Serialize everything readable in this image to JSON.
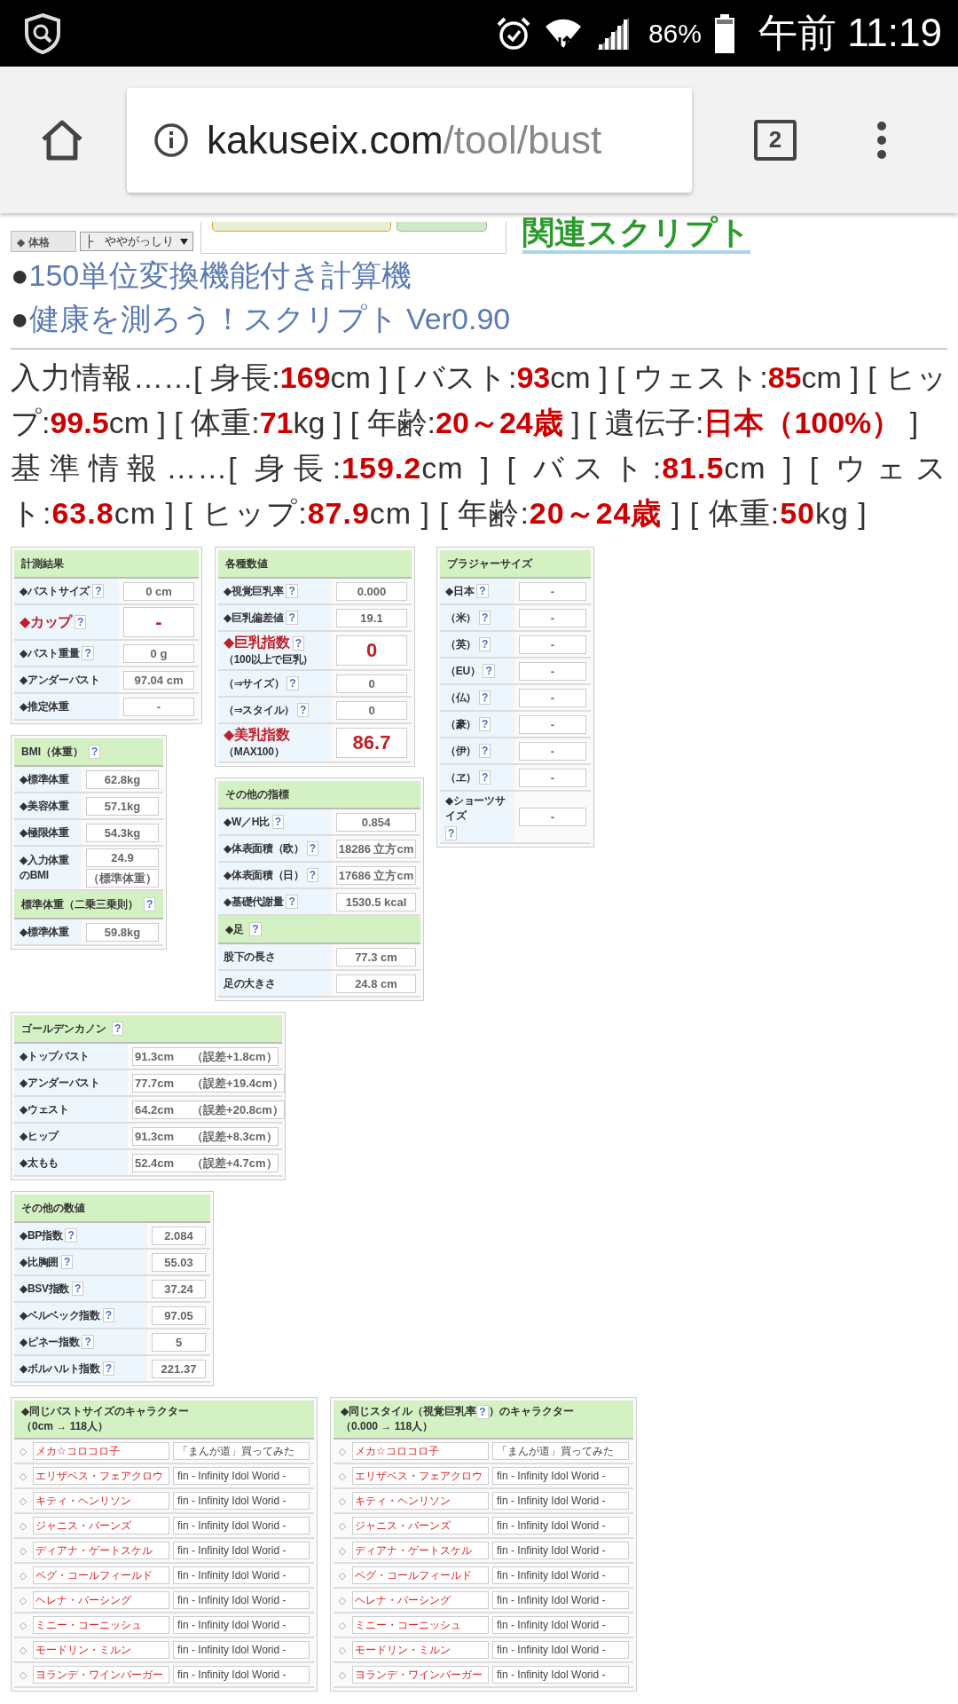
{
  "status_bar": {
    "battery": "86%",
    "time": "午前 11:19"
  },
  "browser": {
    "url_host": "kakuseix.com",
    "url_path": "/tool/bust",
    "tab_count": "2"
  },
  "form_row": {
    "label": "◆ 体格",
    "select_value": "├　ややがっしり"
  },
  "related_heading": "関連スクリプト",
  "links": [
    {
      "bullet": "●",
      "text": "150単位変換機能付き計算機"
    },
    {
      "bullet": "●",
      "text": "健康を測ろう！スクリプト Ver0.90"
    }
  ],
  "info": [
    "入力情報……[ 身長:**169**cm ] [ バスト:**93**cm ] [ ウェスト:**85**cm ] [ ヒップ:**99.5**cm ] [ 体重:**71**kg ] [ 年齢:**20～24歳** ] [ 遺伝子:**日本（100%）** ]",
    "基準情報……[ 身長:**159.2**cm ] [ バスト:**81.5**cm ] [ ウェスト:**63.8**cm ] [ ヒップ:**87.9**cm ] [ 年齢:**20～24歳** ] [ 体重:**50**kg ]"
  ],
  "panels": [
    {
      "title": "計測結果",
      "rows": [
        {
          "kind": "field",
          "label": "◆バストサイズ",
          "help": "?",
          "values": [
            "0 cm"
          ],
          "emphasis": false
        },
        {
          "kind": "field",
          "label": "◆カップ",
          "help": "?",
          "values": [
            "-"
          ],
          "emphasis": true
        },
        {
          "kind": "field",
          "label": "◆バスト重量",
          "help": "?",
          "values": [
            "0 g"
          ],
          "emphasis": false
        },
        {
          "kind": "field",
          "label": "◆アンダーバスト",
          "values": [
            "97.04 cm"
          ],
          "emphasis": false
        },
        {
          "kind": "field",
          "label": "◆推定体重",
          "values": [
            "-"
          ],
          "emphasis": false
        }
      ]
    },
    {
      "title": "各種数値",
      "rows": [
        {
          "kind": "field",
          "label": "◆視覚巨乳率",
          "help": "?",
          "values": [
            "0.000"
          ],
          "emphasis": false
        },
        {
          "kind": "field",
          "label": "◆巨乳偏差値",
          "help": "?",
          "values": [
            "19.1"
          ],
          "emphasis": false
        },
        {
          "kind": "field",
          "label": "◆巨乳指数",
          "help": "?",
          "note": "（100以上で巨乳）",
          "values": [
            "0"
          ],
          "emphasis": true
        },
        {
          "kind": "field",
          "label": "（⇒サイズ）",
          "help": "?",
          "values": [
            "0"
          ],
          "emphasis": false
        },
        {
          "kind": "field",
          "label": "（⇒スタイル）",
          "help": "?",
          "values": [
            "0"
          ],
          "emphasis": false
        },
        {
          "kind": "field",
          "label": "◆美乳指数",
          "note": "（MAX100）",
          "values": [
            "86.7"
          ],
          "emphasis": true
        }
      ]
    },
    {
      "title": "ブラジャーサイズ",
      "rows": [
        {
          "kind": "field",
          "label": "◆日本",
          "help": "?",
          "values": [
            "-"
          ]
        },
        {
          "kind": "field",
          "label": "（米）",
          "help": "?",
          "values": [
            "-"
          ]
        },
        {
          "kind": "field",
          "label": "（英）",
          "help": "?",
          "values": [
            "-"
          ]
        },
        {
          "kind": "field",
          "label": "（EU）",
          "help": "?",
          "values": [
            "-"
          ]
        },
        {
          "kind": "field",
          "label": "（仏）",
          "help": "?",
          "values": [
            "-"
          ]
        },
        {
          "kind": "field",
          "label": "（豪）",
          "help": "?",
          "values": [
            "-"
          ]
        },
        {
          "kind": "field",
          "label": "（伊）",
          "help": "?",
          "values": [
            "-"
          ]
        },
        {
          "kind": "field",
          "label": "（ヱ）",
          "help": "?",
          "values": [
            "-"
          ]
        },
        {
          "kind": "field",
          "label": "◆ショーツサイズ",
          "help": "?",
          "values": [
            "-"
          ]
        }
      ]
    },
    {
      "title": "BMI（体重）",
      "help": "?",
      "rows": [
        {
          "kind": "field",
          "label": "◆標準体重",
          "values": [
            "62.8kg"
          ]
        },
        {
          "kind": "field",
          "label": "◆美容体重",
          "values": [
            "57.1kg"
          ]
        },
        {
          "kind": "field",
          "label": "◆極限体重",
          "values": [
            "54.3kg"
          ]
        },
        {
          "kind": "field",
          "label": "◆入力体重のBMI",
          "values": [
            "24.9",
            "（標準体重）"
          ]
        },
        {
          "kind": "header",
          "label": "標準体重（二乗三乗則）",
          "help": "?"
        },
        {
          "kind": "field",
          "label": "◆標準体重",
          "values": [
            "59.8kg"
          ]
        }
      ]
    },
    {
      "title": "その他の指標",
      "rows": [
        {
          "kind": "field",
          "label": "◆W／H比",
          "help": "?",
          "values": [
            "0.854"
          ]
        },
        {
          "kind": "field",
          "label": "◆体表面積（欧）",
          "help": "?",
          "values": [
            "18286 立方cm"
          ]
        },
        {
          "kind": "field",
          "label": "◆体表面積（日）",
          "help": "?",
          "values": [
            "17686 立方cm"
          ]
        },
        {
          "kind": "field",
          "label": "◆基礎代謝量",
          "help": "?",
          "values": [
            "1530.5 kcal"
          ]
        },
        {
          "kind": "header",
          "label": "◆足",
          "help": "?"
        },
        {
          "kind": "field",
          "label": "股下の長さ",
          "values": [
            "77.3 cm"
          ]
        },
        {
          "kind": "field",
          "label": "足の大きさ",
          "values": [
            "24.8 cm"
          ]
        }
      ]
    },
    {
      "title": "ゴールデンカノン",
      "help": "?",
      "rows": [
        {
          "kind": "field",
          "label": "◆トップバスト",
          "values": [
            "91.3cm"
          ],
          "error": "（誤差+1.8cm）"
        },
        {
          "kind": "field",
          "label": "◆アンダーバスト",
          "values": [
            "77.7cm"
          ],
          "error": "（誤差+19.4cm）"
        },
        {
          "kind": "field",
          "label": "◆ウェスト",
          "values": [
            "64.2cm"
          ],
          "error": "（誤差+20.8cm）"
        },
        {
          "kind": "field",
          "label": "◆ヒップ",
          "values": [
            "91.3cm"
          ],
          "error": "（誤差+8.3cm）"
        },
        {
          "kind": "field",
          "label": "◆太もも",
          "values": [
            "52.4cm"
          ],
          "error": "（誤差+4.7cm）"
        }
      ]
    },
    {
      "title": "その他の数値",
      "rows": [
        {
          "kind": "field",
          "label": "◆BP指数",
          "help": "?",
          "values": [
            "2.084"
          ]
        },
        {
          "kind": "field",
          "label": "◆比胸囲",
          "help": "?",
          "values": [
            "55.03"
          ]
        },
        {
          "kind": "field",
          "label": "◆BSV指数",
          "help": "?",
          "values": [
            "37.24"
          ]
        },
        {
          "kind": "field",
          "label": "◆ベルベック指数",
          "help": "?",
          "values": [
            "97.05"
          ]
        },
        {
          "kind": "field",
          "label": "◆ピネー指数",
          "help": "?",
          "values": [
            "5"
          ]
        },
        {
          "kind": "field",
          "label": "◆ボルハルト指数",
          "help": "?",
          "values": [
            "221.37"
          ]
        }
      ]
    }
  ],
  "character_tables": [
    {
      "title": "◆同じバストサイズのキャラクター",
      "subtitle": "（0cm → 118人）",
      "bullet": "◇",
      "rows": [
        {
          "name": "メカ☆コロコロ子",
          "source": "「まんが道」買ってみた"
        },
        {
          "name": "エリザベス・フェアクロウ",
          "source": "fin - Infinity Idol Worid -"
        },
        {
          "name": "キティ・ヘンリソン",
          "source": "fin - Infinity Idol Worid -"
        },
        {
          "name": "ジャニス・バーンズ",
          "source": "fin - Infinity Idol Worid -"
        },
        {
          "name": "ディアナ・ゲートスケル",
          "source": "fin - Infinity Idol Worid -"
        },
        {
          "name": "ペグ・コールフィールド",
          "source": "fin - Infinity Idol Worid -"
        },
        {
          "name": "ヘレナ・パーシング",
          "source": "fin - Infinity Idol Worid -"
        },
        {
          "name": "ミニー・コーニッシュ",
          "source": "fin - Infinity Idol Worid -"
        },
        {
          "name": "モードリン・ミルン",
          "source": "fin - Infinity Idol Worid -"
        },
        {
          "name": "ヨランデ・ワインバーガー",
          "source": "fin - Infinity Idol Worid -"
        }
      ]
    },
    {
      "title": "◆同じスタイル（視覚巨乳率",
      "help": "?",
      "title_after": "）のキャラクター",
      "subtitle": "（0.000 → 118人）",
      "bullet": "◇",
      "rows": [
        {
          "name": "メカ☆コロコロ子",
          "source": "「まんが道」買ってみた"
        },
        {
          "name": "エリザベス・フェアクロウ",
          "source": "fin - Infinity Idol Worid -"
        },
        {
          "name": "キティ・ヘンリソン",
          "source": "fin - Infinity Idol Worid -"
        },
        {
          "name": "ジャニス・バーンズ",
          "source": "fin - Infinity Idol Worid -"
        },
        {
          "name": "ディアナ・ゲートスケル",
          "source": "fin - Infinity Idol Worid -"
        },
        {
          "name": "ペグ・コールフィールド",
          "source": "fin - Infinity Idol Worid -"
        },
        {
          "name": "ヘレナ・パーシング",
          "source": "fin - Infinity Idol Worid -"
        },
        {
          "name": "ミニー・コーニッシュ",
          "source": "fin - Infinity Idol Worid -"
        },
        {
          "name": "モードリン・ミルン",
          "source": "fin - Infinity Idol Worid -"
        },
        {
          "name": "ヨランデ・ワインバーガー",
          "source": "fin - Infinity Idol Worid -"
        }
      ]
    }
  ]
}
